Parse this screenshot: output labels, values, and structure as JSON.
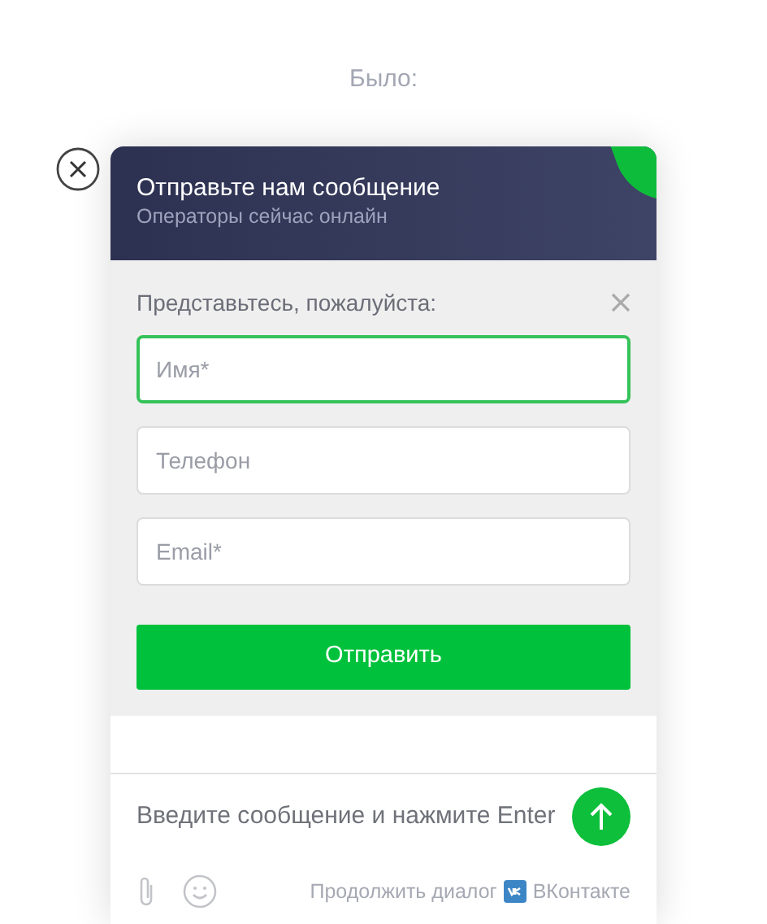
{
  "caption": "Было:",
  "header": {
    "title": "Отправьте нам сообщение",
    "subtitle": "Операторы сейчас онлайн",
    "online": true
  },
  "form": {
    "prompt": "Представьтесь, пожалуйста:",
    "fields": [
      {
        "placeholder": "Имя*",
        "focused": true
      },
      {
        "placeholder": "Телефон",
        "focused": false
      },
      {
        "placeholder": "Email*",
        "focused": false
      }
    ],
    "submit": "Отправить"
  },
  "message": {
    "placeholder": "Введите сообщение и нажмите Enter"
  },
  "footer": {
    "continue": "Продолжить диалог",
    "network": "ВКонтакте"
  }
}
